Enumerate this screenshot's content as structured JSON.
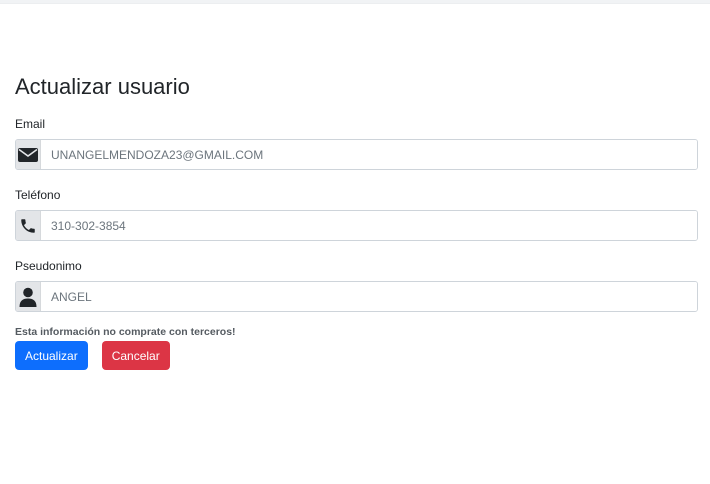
{
  "page": {
    "title": "Actualizar usuario"
  },
  "form": {
    "email": {
      "label": "Email",
      "value": "UNANGELMENDOZA23@GMAIL.COM",
      "icon": "envelope-icon"
    },
    "phone": {
      "label": "Teléfono",
      "value": "310-302-3854",
      "icon": "phone-icon"
    },
    "nickname": {
      "label": "Pseudonimo",
      "value": "ANGEL",
      "icon": "user-icon"
    },
    "note": "Esta información no comprate con terceros!",
    "buttons": {
      "update": "Actualizar",
      "cancel": "Cancelar"
    }
  },
  "colors": {
    "primary": "#0d6efd",
    "danger": "#dc3545",
    "addon_bg": "#e3e5e8",
    "border": "#ced4da"
  }
}
